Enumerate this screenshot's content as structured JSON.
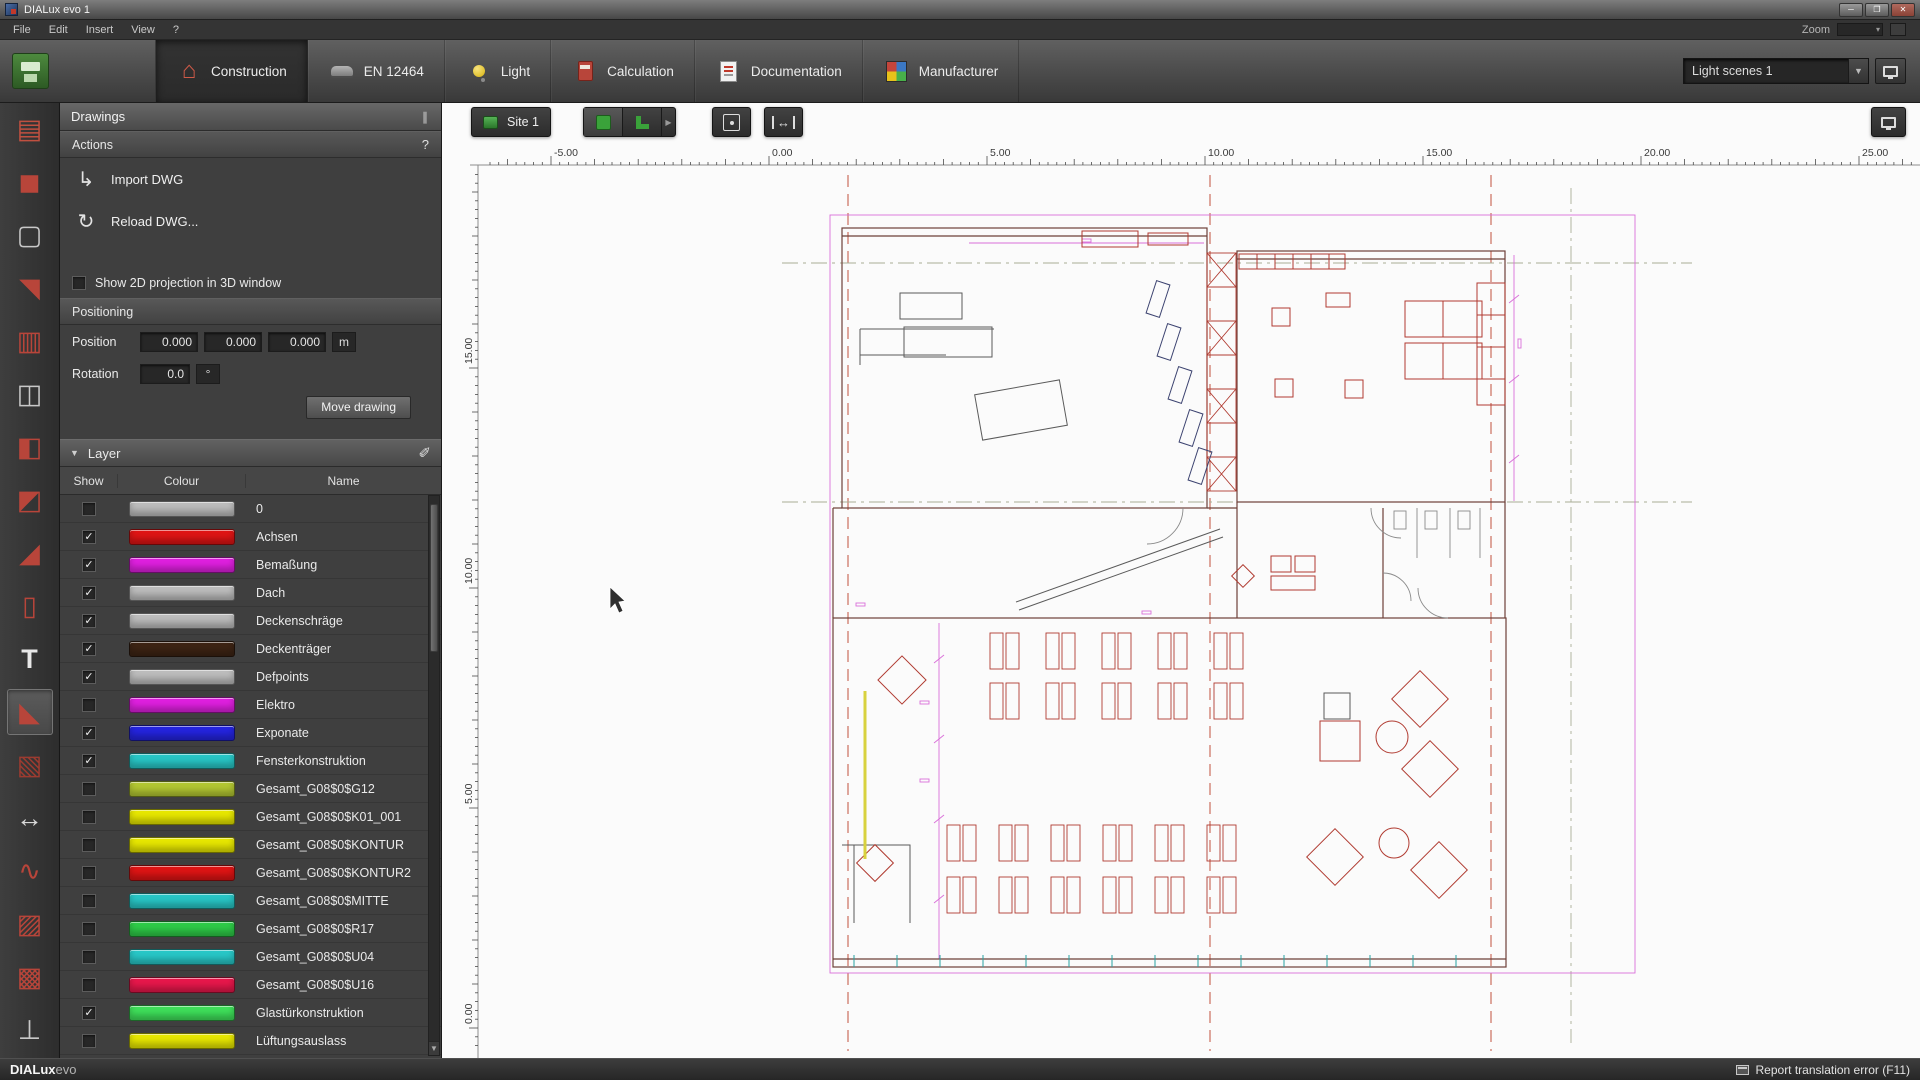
{
  "window": {
    "title": "DIALux evo 1",
    "minimize_glyph": "─",
    "maximize_glyph": "❐",
    "close_glyph": "✕"
  },
  "menubar": {
    "items": [
      "File",
      "Edit",
      "Insert",
      "View",
      "?"
    ],
    "zoom_label": "Zoom"
  },
  "main_toolbar": {
    "tabs": [
      {
        "label": "Construction",
        "icon": "construction-icon",
        "selected": true
      },
      {
        "label": "EN 12464",
        "icon": "street-icon",
        "selected": false
      },
      {
        "label": "Light",
        "icon": "light-icon",
        "selected": false
      },
      {
        "label": "Calculation",
        "icon": "calculation-icon",
        "selected": false
      },
      {
        "label": "Documentation",
        "icon": "documentation-icon",
        "selected": false
      },
      {
        "label": "Manufacturer",
        "icon": "manufacturer-icon",
        "selected": false
      }
    ],
    "light_scenes_value": "Light scenes 1"
  },
  "tool_strip": {
    "tools": [
      {
        "name": "furnishing-tool",
        "glyph": "▤",
        "color": "#c05040",
        "selected": false
      },
      {
        "name": "building-tool",
        "glyph": "◼",
        "color": "#b8453a",
        "selected": false
      },
      {
        "name": "storey-tool",
        "glyph": "▢",
        "color": "#c8c8c8",
        "selected": false
      },
      {
        "name": "roof-tool",
        "glyph": "◥",
        "color": "#b8453a",
        "selected": false
      },
      {
        "name": "window-tool",
        "glyph": "▥",
        "color": "#b8453a",
        "selected": false
      },
      {
        "name": "room-tool",
        "glyph": "◫",
        "color": "#c8c8c8",
        "selected": false
      },
      {
        "name": "door-tool",
        "glyph": "◧",
        "color": "#b8453a",
        "selected": false
      },
      {
        "name": "ceiling-tool",
        "glyph": "◩",
        "color": "#b8453a",
        "selected": false
      },
      {
        "name": "ramp-tool",
        "glyph": "◢",
        "color": "#b8453a",
        "selected": false
      },
      {
        "name": "column-tool",
        "glyph": "▯",
        "color": "#b8453a",
        "selected": false
      },
      {
        "name": "text-tool",
        "glyph": "T",
        "color": "#e8e8e8",
        "selected": false
      },
      {
        "name": "drawing-tool",
        "glyph": "◣",
        "color": "#b8453a",
        "selected": true
      },
      {
        "name": "materials-tool",
        "glyph": "▧",
        "color": "#9c3b30",
        "selected": false
      },
      {
        "name": "dimension-tool",
        "glyph": "↔",
        "color": "#d8d8d8",
        "selected": false
      },
      {
        "name": "polyline-tool",
        "glyph": "∿",
        "color": "#b8453a",
        "selected": false
      },
      {
        "name": "image-tool",
        "glyph": "▨",
        "color": "#b8453a",
        "selected": false
      },
      {
        "name": "palette-tool",
        "glyph": "▩",
        "color": "#b8453a",
        "selected": false
      },
      {
        "name": "lamp-pole-tool",
        "glyph": "⊥",
        "color": "#c8c8c8",
        "selected": false
      }
    ]
  },
  "sidebar": {
    "title": "Drawings",
    "grip_glyph": "∥",
    "actions": {
      "header": "Actions",
      "help_glyph": "?",
      "import_glyph": "↳",
      "import_label": "Import DWG",
      "reload_glyph": "↻",
      "reload_label": "Reload DWG..."
    },
    "projection_label": "Show 2D projection in 3D window",
    "projection_checked": false,
    "positioning": {
      "header": "Positioning",
      "position_label": "Position",
      "position_values": [
        "0.000",
        "0.000",
        "0.000"
      ],
      "position_unit": "m",
      "rotation_label": "Rotation",
      "rotation_value": "0.0",
      "rotation_unit": "°",
      "move_button_label": "Move drawing"
    },
    "layer": {
      "header": "Layer",
      "pin_glyph": "✐",
      "check_glyph": "✓",
      "columns": [
        "Show",
        "Colour",
        "Name"
      ],
      "rows": [
        {
          "name": "0",
          "checked": false,
          "color": "#bdbdbd"
        },
        {
          "name": "Achsen",
          "checked": true,
          "color": "#e01414"
        },
        {
          "name": "Bemaßung",
          "checked": true,
          "color": "#e020e0"
        },
        {
          "name": "Dach",
          "checked": true,
          "color": "#bdbdbd"
        },
        {
          "name": "Deckenschräge",
          "checked": true,
          "color": "#bdbdbd"
        },
        {
          "name": "Deckenträger",
          "checked": true,
          "color": "#3d2414"
        },
        {
          "name": "Defpoints",
          "checked": true,
          "color": "#bdbdbd"
        },
        {
          "name": "Elektro",
          "checked": false,
          "color": "#e020e0"
        },
        {
          "name": "Exponate",
          "checked": true,
          "color": "#2424e0"
        },
        {
          "name": "Fensterkonstruktion",
          "checked": true,
          "color": "#28c8c8"
        },
        {
          "name": "Gesamt_G08$0$G12",
          "checked": false,
          "color": "#b4c832"
        },
        {
          "name": "Gesamt_G08$0$K01_001",
          "checked": false,
          "color": "#e8e800"
        },
        {
          "name": "Gesamt_G08$0$KONTUR",
          "checked": false,
          "color": "#e8e800"
        },
        {
          "name": "Gesamt_G08$0$KONTUR2",
          "checked": false,
          "color": "#e01414"
        },
        {
          "name": "Gesamt_G08$0$MITTE",
          "checked": false,
          "color": "#28c8c8"
        },
        {
          "name": "Gesamt_G08$0$R17",
          "checked": false,
          "color": "#2ecc48"
        },
        {
          "name": "Gesamt_G08$0$U04",
          "checked": false,
          "color": "#28c8c8"
        },
        {
          "name": "Gesamt_G08$0$U16",
          "checked": false,
          "color": "#e8174b"
        },
        {
          "name": "Glastürkonstruktion",
          "checked": true,
          "color": "#3fe05a"
        },
        {
          "name": "Lüftungsauslass",
          "checked": false,
          "color": "#e8e800"
        }
      ]
    }
  },
  "canvas_toolbar": {
    "site_label": "Site 1"
  },
  "rulers": {
    "top": [
      {
        "value": -5,
        "label": "-5.00"
      },
      {
        "value": 0,
        "label": "0.00"
      },
      {
        "value": 5,
        "label": "5.00"
      },
      {
        "value": 10,
        "label": "10.00"
      },
      {
        "value": 15,
        "label": "15.00"
      },
      {
        "value": 20,
        "label": "20.00"
      },
      {
        "value": 25,
        "label": "25.00"
      }
    ],
    "left": [
      {
        "value": 15,
        "label": "15.00"
      },
      {
        "value": 10,
        "label": "10.00"
      },
      {
        "value": 5,
        "label": "5.00"
      },
      {
        "value": 0,
        "label": "0.00"
      }
    ]
  },
  "statusbar": {
    "brand": "DIALux",
    "brand_suffix": "evo",
    "report_label": "Report translation error (F11)"
  }
}
